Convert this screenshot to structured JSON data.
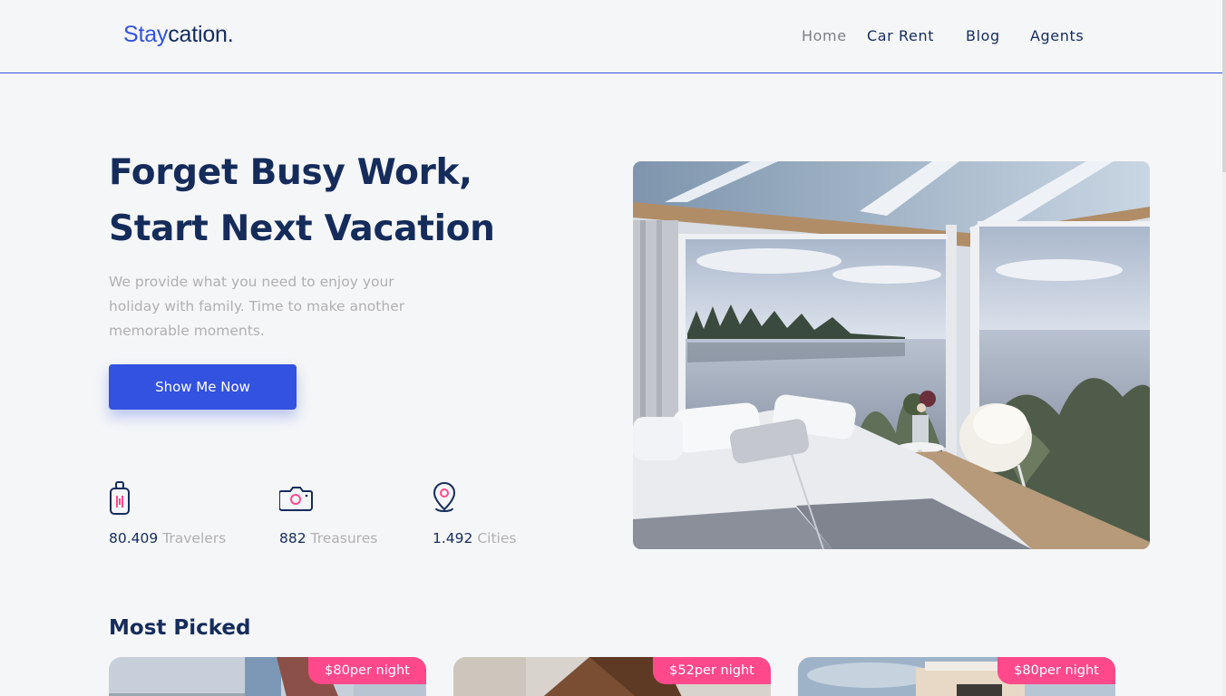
{
  "brand": {
    "part1": "Stay",
    "part2": "cation."
  },
  "nav": {
    "items": [
      "Home",
      "Car Rent",
      "Blog",
      "Agents"
    ],
    "active": "Home"
  },
  "hero": {
    "title_line1": "Forget Busy Work,",
    "title_line2": "Start Next Vacation",
    "description": "We provide what you need to enjoy your holiday with family. Time to make another memorable moments.",
    "cta_label": "Show Me Now"
  },
  "stats": [
    {
      "icon": "suitcase-icon",
      "value": "80.409",
      "label": "Travelers"
    },
    {
      "icon": "camera-icon",
      "value": "882",
      "label": "Treasures"
    },
    {
      "icon": "map-pin-icon",
      "value": "1.492",
      "label": "Cities"
    }
  ],
  "most_picked": {
    "title": "Most Picked",
    "cards": [
      {
        "price": "$80",
        "unit": "per night"
      },
      {
        "price": "$52",
        "unit": "per night"
      },
      {
        "price": "$80",
        "unit": "per night"
      }
    ]
  },
  "colors": {
    "primary": "#3252df",
    "dark": "#152c5b",
    "muted": "#b0b0b0",
    "accent": "#ff498b",
    "background": "#f5f6f8"
  }
}
